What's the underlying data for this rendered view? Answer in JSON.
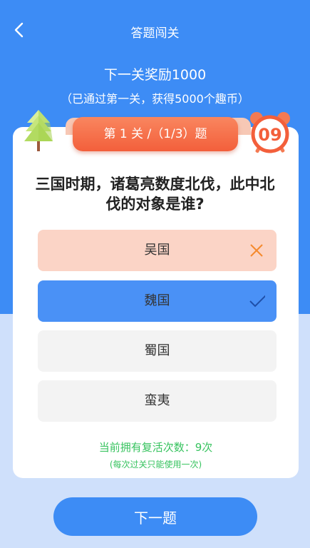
{
  "header": {
    "title": "答题闯关"
  },
  "reward": {
    "title": "下一关奖励1000",
    "subtitle": "（已通过第一关，获得5000个趣币）"
  },
  "level": {
    "label": "第 1 关 /（1/3）题"
  },
  "timer": {
    "value": "09"
  },
  "question": {
    "text": "三国时期，诸葛亮数度北伐，此中北伐的对象是谁?"
  },
  "options": [
    {
      "label": "吴国",
      "state": "wrong"
    },
    {
      "label": "魏国",
      "state": "correct"
    },
    {
      "label": "蜀国",
      "state": "normal"
    },
    {
      "label": "蛮夷",
      "state": "normal"
    }
  ],
  "revive": {
    "text": "当前拥有复活次数：9次",
    "note": "(每次过关只能使用一次)"
  },
  "footer": {
    "next_label": "下一题"
  },
  "colors": {
    "primary": "#3d8cf5",
    "accent": "#f35f3b",
    "wrong_bg": "#fbd4c6",
    "correct_bg": "#4a91f6",
    "success_text": "#37c35f"
  }
}
